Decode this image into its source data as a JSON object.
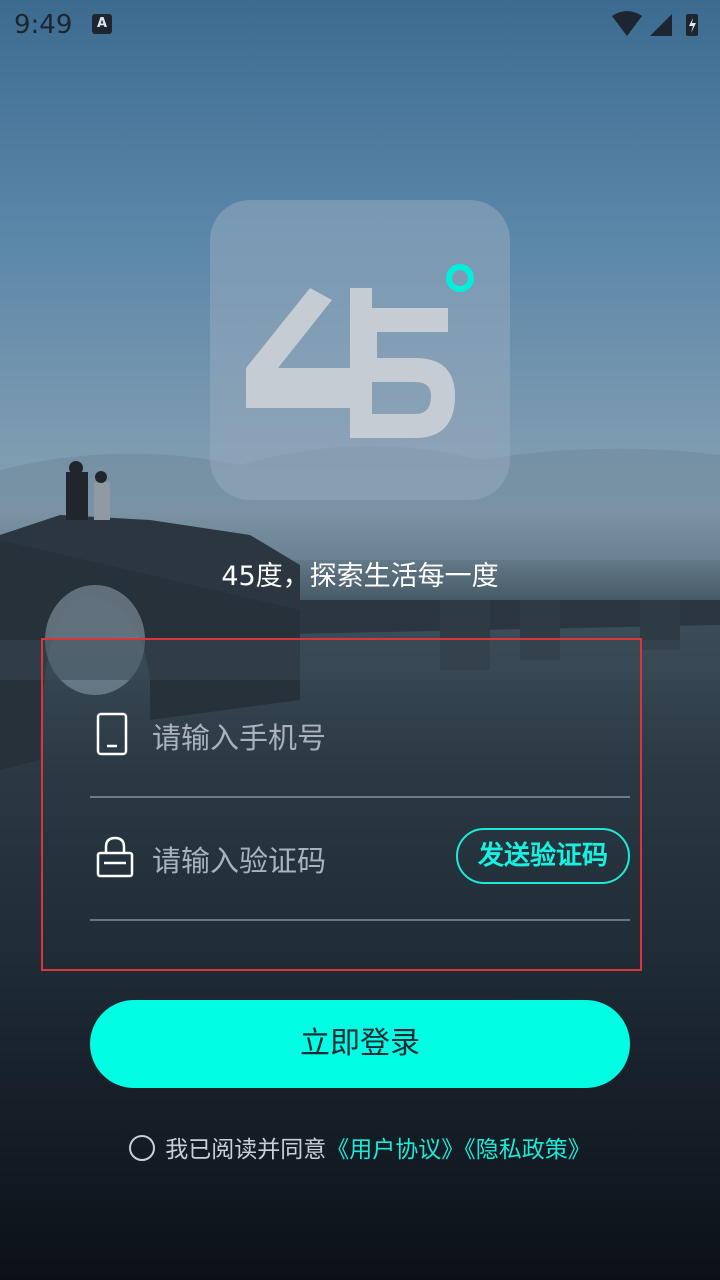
{
  "status_bar": {
    "time": "9:49",
    "badge": "A"
  },
  "app": {
    "logo_text": "45",
    "slogan": "45度，探索生活每一度"
  },
  "form": {
    "phone": {
      "placeholder": "请输入手机号",
      "value": ""
    },
    "code": {
      "placeholder": "请输入验证码",
      "value": "",
      "send_label": "发送验证码"
    }
  },
  "login_label": "立即登录",
  "agreement": {
    "prefix": "我已阅读并同意",
    "user_agreement": "《用户协议》",
    "privacy_policy": "《隐私政策》"
  },
  "colors": {
    "accent": "#00fde4",
    "highlight_outline": "#d9363a"
  }
}
